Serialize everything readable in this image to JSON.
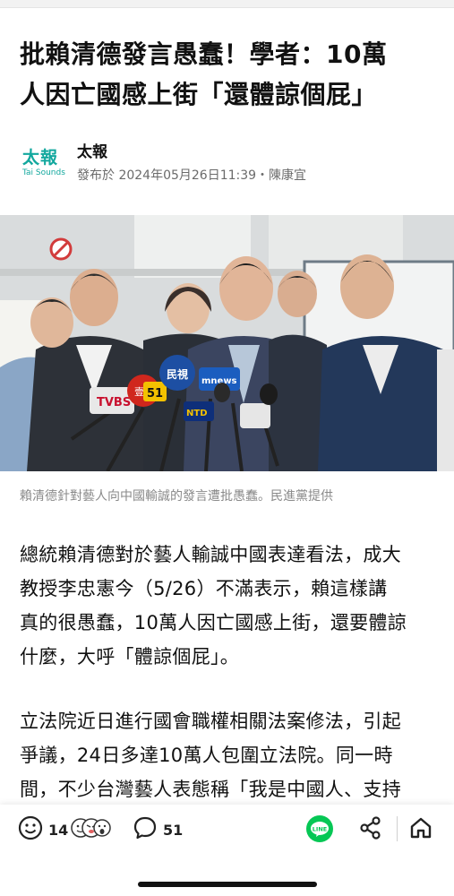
{
  "article": {
    "headline_line1": "批賴清德發言愚蠢！學者：10萬",
    "headline_line2": "人因亡國感上街「還體諒個屁」",
    "publisher": {
      "logo_text": "太報",
      "logo_sub": "Tai Sounds",
      "name": "太報",
      "meta": "發布於 2024年05月26日11:39・陳康宜"
    },
    "photo": {
      "mic_labels": [
        "TVBS",
        "民視",
        "mnews",
        "壹",
        "51",
        "NTD"
      ]
    },
    "caption": "賴清德針對藝人向中國輸誠的發言遭批愚蠢。民進黨提供",
    "paragraph1": [
      "總統賴清德對於藝人輸誠中國表達看法，成大",
      "教授李忠憲今（5/26）不滿表示，賴這樣講",
      "真的很愚蠢，10萬人因亡國感上街，還要體諒",
      "什麼，大呼「體諒個屁」。"
    ],
    "paragraph2": [
      "立法院近日進行國會職權相關法案修法，引起",
      "爭議，24日多達10萬人包圍立法院。同一時",
      "間，不少台灣藝人表態稱「我是中國人、支持"
    ]
  },
  "bottom_bar": {
    "reaction_count": "14",
    "comment_count": "51",
    "line_label": "LINE",
    "colors": {
      "line_green": "#06c755",
      "text": "#222222"
    },
    "icons": [
      "smiley-icon",
      "reaction-emojis-icon",
      "comment-icon",
      "line-share-icon",
      "share-icon",
      "home-icon"
    ]
  }
}
